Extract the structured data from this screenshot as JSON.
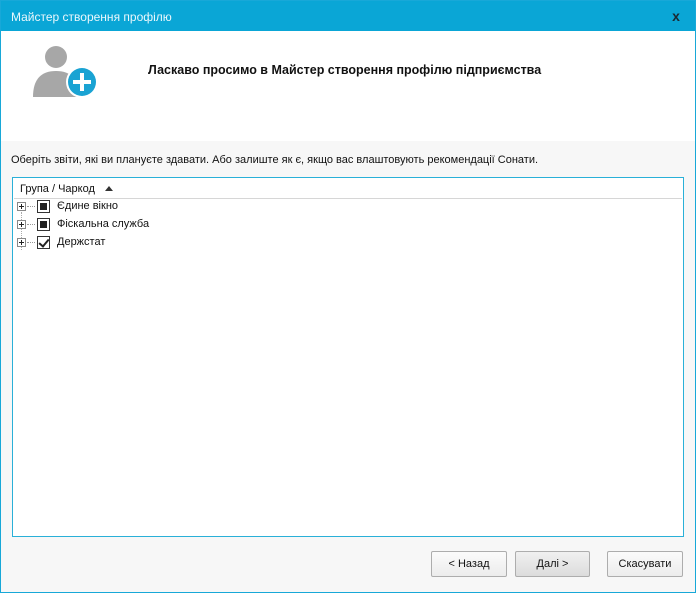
{
  "window": {
    "title": "Майстер створення профілю",
    "close_symbol": "x"
  },
  "header": {
    "icon": "user-add-icon",
    "welcome_text": "Ласкаво просимо в Майстер створення профілю підприємства"
  },
  "instruction": "Оберіть звіти, які ви плануєте здавати. Або залиште як є, якщо вас влаштовують рекомендації Сонати.",
  "tree": {
    "column_header": "Група / Чаркод",
    "sort": "ascending",
    "nodes": [
      {
        "label": "Єдине вікно",
        "state": "partial",
        "expanded": false
      },
      {
        "label": "Фіскальна служба",
        "state": "partial",
        "expanded": false
      },
      {
        "label": "Держстат",
        "state": "checked",
        "expanded": false
      }
    ]
  },
  "buttons": {
    "back": "< Назад",
    "next": "Далі >",
    "cancel": "Скасувати"
  },
  "colors": {
    "titlebar": "#0aa6d6",
    "accent_border": "#2ab0d8",
    "avatar_gray": "#a7a7a7",
    "plus_badge": "#1aa3d3"
  }
}
